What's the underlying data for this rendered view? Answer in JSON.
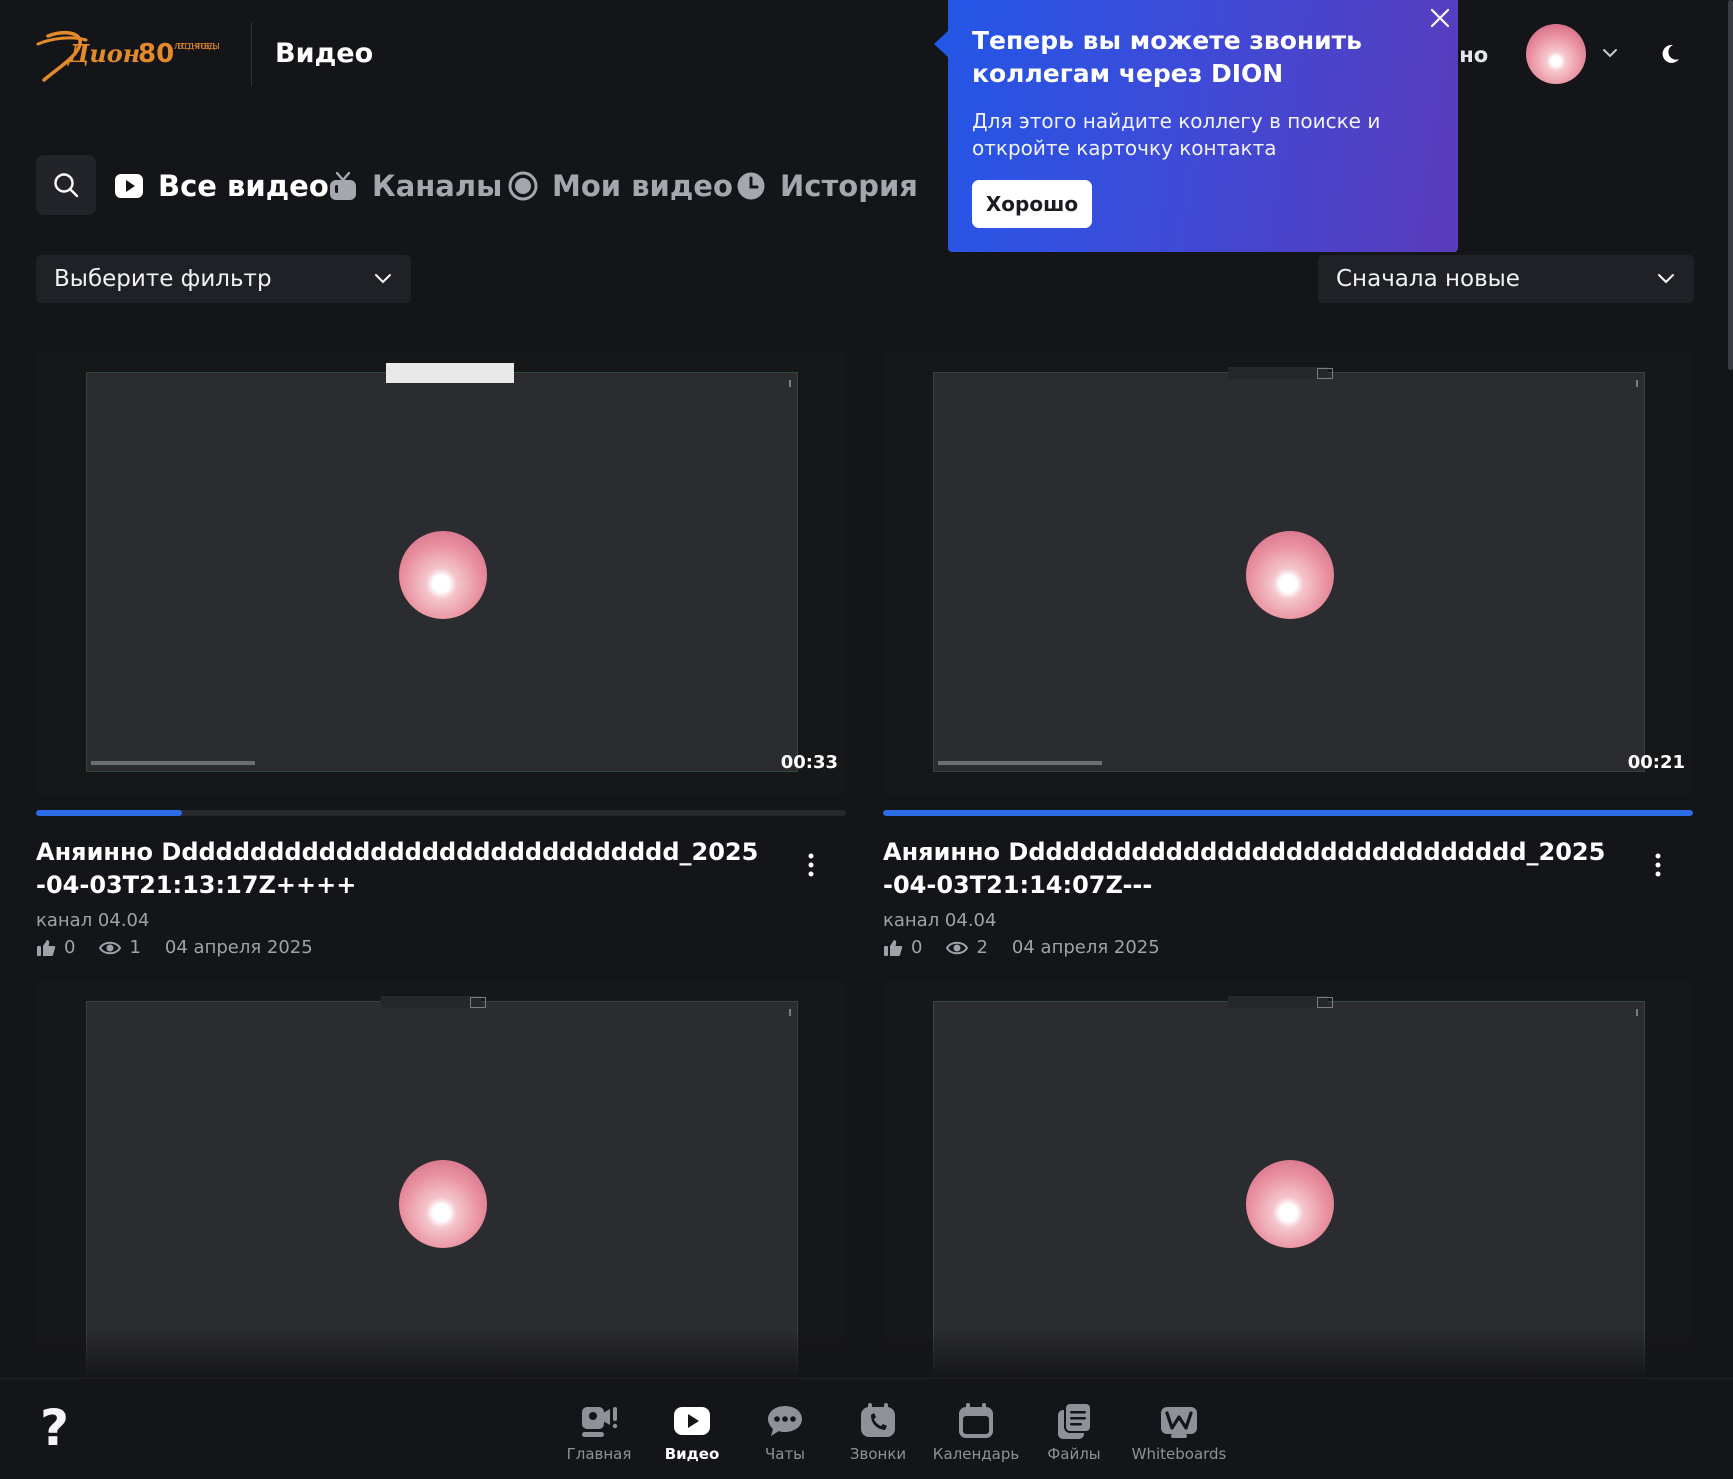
{
  "header": {
    "page_title": "Видео",
    "user_name_fragment": "инно",
    "logo_text": "Дион",
    "logo_anniversary": "80",
    "logo_caption": "ЛЕТ СО ДНЯ ПОБЕДЫ!"
  },
  "tabs": [
    {
      "label": "Все видео",
      "icon": "play-icon",
      "active": true
    },
    {
      "label": "Каналы",
      "icon": "tv-icon",
      "active": false
    },
    {
      "label": "Мои видео",
      "icon": "record-icon",
      "active": false
    },
    {
      "label": "История",
      "icon": "clock-icon",
      "active": false
    }
  ],
  "toast": {
    "title": "Теперь вы можете звонить коллегам через DION",
    "text": "Для этого найдите коллегу в поиске и откройте карточку контакта",
    "button": "Хорошо"
  },
  "filters": {
    "filter_placeholder": "Выберите фильтр",
    "sort_value": "Сначала новые"
  },
  "videos": [
    {
      "title": "Аняинно Dddddddddddddddddddddddddddddd_2025-04-03T21:13:17Z++++",
      "duration": "00:33",
      "channel": "канал 04.04",
      "likes": "0",
      "views": "1",
      "date": "04 апреля 2025",
      "watched_fraction": 0.18
    },
    {
      "title": "Аняинно Dddddddddddddddddddddddddddddd_2025-04-03T21:14:07Z---",
      "duration": "00:21",
      "channel": "канал 04.04",
      "likes": "0",
      "views": "2",
      "date": "04 апреля 2025",
      "watched_fraction": 1.0
    },
    {
      "title": "",
      "duration": ""
    },
    {
      "title": "",
      "duration": ""
    }
  ],
  "bottom_nav": [
    {
      "label": "Главная",
      "icon": "home-icon",
      "active": false
    },
    {
      "label": "Видео",
      "icon": "video-icon",
      "active": true
    },
    {
      "label": "Чаты",
      "icon": "chat-icon",
      "active": false
    },
    {
      "label": "Звонки",
      "icon": "phone-icon",
      "active": false
    },
    {
      "label": "Календарь",
      "icon": "calendar-icon",
      "active": false
    },
    {
      "label": "Файлы",
      "icon": "files-icon",
      "active": false
    },
    {
      "label": "Whiteboards",
      "icon": "whiteboard-icon",
      "active": false
    }
  ],
  "help": {
    "label": "?"
  },
  "colors": {
    "accent": "#2d6ae6",
    "toast_start": "#2456e6",
    "toast_end": "#5a3bbb",
    "logo": "#e48a2a"
  }
}
